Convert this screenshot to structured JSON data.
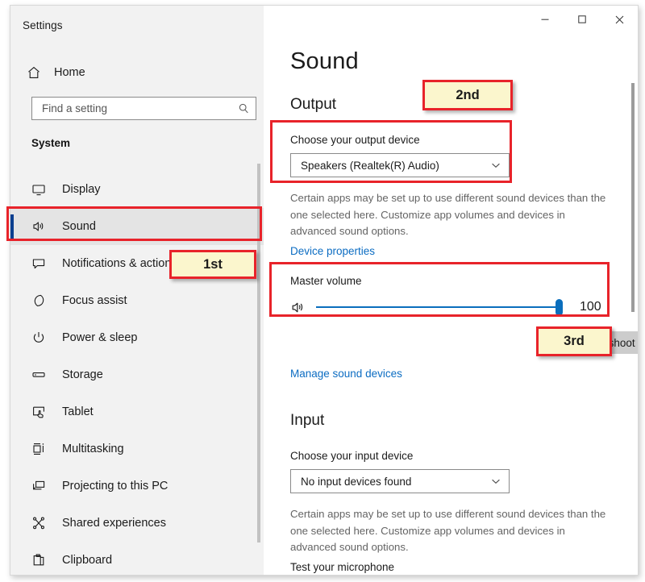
{
  "window": {
    "app_title": "Settings",
    "controls": {
      "minimize": "minimize-button",
      "maximize": "maximize-button",
      "close": "close-button"
    }
  },
  "sidebar": {
    "home_label": "Home",
    "home_icon": "home-icon",
    "search": {
      "placeholder": "Find a setting",
      "value": "",
      "icon": "search-icon"
    },
    "group_title": "System",
    "items": [
      {
        "label": "Display",
        "icon": "monitor-icon",
        "selected": false
      },
      {
        "label": "Sound",
        "icon": "speaker-icon",
        "selected": true
      },
      {
        "label": "Notifications & actions",
        "icon": "comment-icon",
        "selected": false
      },
      {
        "label": "Focus assist",
        "icon": "moon-icon",
        "selected": false
      },
      {
        "label": "Power & sleep",
        "icon": "power-icon",
        "selected": false
      },
      {
        "label": "Storage",
        "icon": "drive-icon",
        "selected": false
      },
      {
        "label": "Tablet",
        "icon": "tablet-icon",
        "selected": false
      },
      {
        "label": "Multitasking",
        "icon": "multitasking-icon",
        "selected": false
      },
      {
        "label": "Projecting to this PC",
        "icon": "project-icon",
        "selected": false
      },
      {
        "label": "Shared experiences",
        "icon": "share-icon",
        "selected": false
      },
      {
        "label": "Clipboard",
        "icon": "clipboard-icon",
        "selected": false
      }
    ]
  },
  "main": {
    "page_title": "Sound",
    "output": {
      "heading": "Output",
      "device_label": "Choose your output device",
      "device_value": "Speakers (Realtek(R) Audio)",
      "description": "Certain apps may be set up to use different sound devices than the one selected here. Customize app volumes and devices in advanced sound options.",
      "device_properties_link": "Device properties",
      "volume_label": "Master volume",
      "volume_value": "100",
      "volume_percent": 100,
      "volume_icon": "speaker-icon",
      "troubleshoot_button": "Troubleshoot",
      "troubleshoot_icon": "warning-triangle-icon",
      "manage_link": "Manage sound devices"
    },
    "input": {
      "heading": "Input",
      "device_label": "Choose your input device",
      "device_value": "No input devices found",
      "description": "Certain apps may be set up to use different sound devices than the one selected here. Customize app volumes and devices in advanced sound options.",
      "test_microphone": "Test your microphone"
    }
  },
  "annotations": {
    "accent_color": "#e8232a",
    "badge_fill": "#fbf6cd",
    "badges": [
      {
        "label": "1st",
        "target": "sidebar-item-sound"
      },
      {
        "label": "2nd",
        "target": "output-device-group"
      },
      {
        "label": "3rd",
        "target": "master-volume-group"
      }
    ]
  }
}
